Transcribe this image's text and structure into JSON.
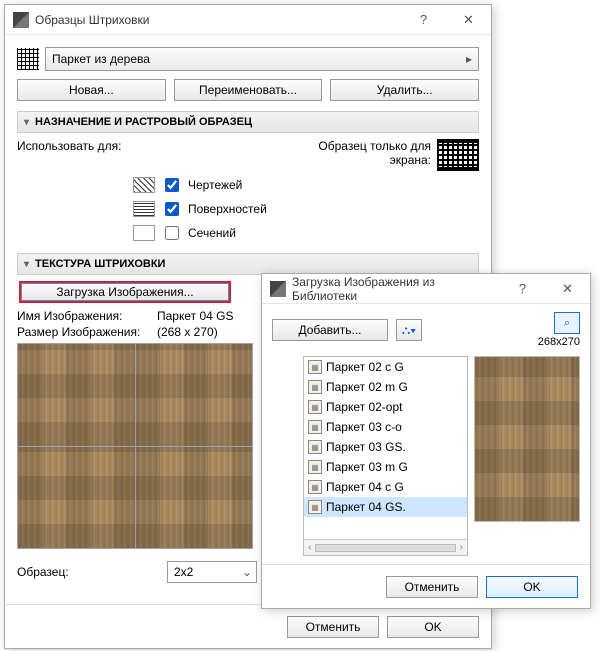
{
  "dialog": {
    "title": "Образцы Штриховки",
    "hatch_name": "Паркет из дерева",
    "buttons": {
      "new": "Новая...",
      "rename": "Переименовать...",
      "delete": "Удалить..."
    },
    "section_assign": "НАЗНАЧЕНИЕ И РАСТРОВЫЙ ОБРАЗЕЦ",
    "use_for_label": "Использовать для:",
    "screen_only": "Образец только для экрана:",
    "chk": {
      "drawings": "Чертежей",
      "surfaces": "Поверхностей",
      "cuts": "Сечений"
    },
    "section_texture": "ТЕКСТУРА ШТРИХОВКИ",
    "load_image": "Загрузка Изображения...",
    "image_name_label": "Имя Изображения:",
    "image_name_value": "Паркет 04 GS",
    "image_size_label": "Размер Изображения:",
    "image_size_value": "(268 x 270)",
    "sample_label": "Образец:",
    "sample_value": "2x2",
    "ok": "OK",
    "cancel": "Отменить"
  },
  "library": {
    "title": "Загрузка Изображения из Библиотеки",
    "add": "Добавить...",
    "zoom": "268x270",
    "items": [
      "Паркет 02 c G",
      "Паркет 02 m G",
      "Паркет 02-opt",
      "Паркет 03 c-o",
      "Паркет 03 GS.",
      "Паркет 03 m G",
      "Паркет 04 c G",
      "Паркет 04 GS."
    ],
    "selected_index": 7,
    "ok": "OK",
    "cancel": "Отменить"
  }
}
